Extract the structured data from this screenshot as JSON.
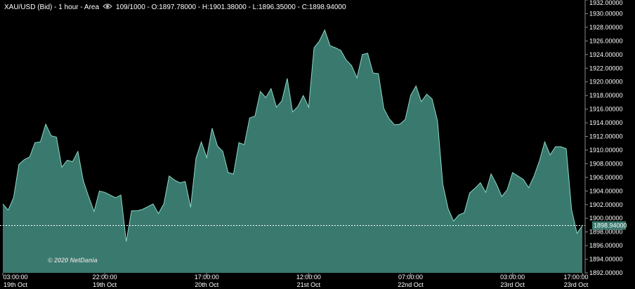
{
  "header": {
    "instrument": "XAU/USD (Bid) - 1 hour - Area",
    "stats": "109/1000 - O:1897.78000 - H:1901.38000 - L:1896.35000 - C:1898.94000",
    "eye_icon": "eye-icon"
  },
  "watermark": "© 2020 NetDania",
  "colors": {
    "area_fill": "#3a7a6e",
    "area_line": "#8ad8c6",
    "background": "#000000",
    "last_price_box": "#3a7a6e"
  },
  "chart_data": {
    "type": "area",
    "title": "XAU/USD (Bid) - 1 hour - Area",
    "ylim": [
      1892,
      1932
    ],
    "y_ticks": [
      "1932.00000",
      "1930.00000",
      "1928.00000",
      "1926.00000",
      "1924.00000",
      "1922.00000",
      "1920.00000",
      "1918.00000",
      "1916.00000",
      "1914.00000",
      "1912.00000",
      "1910.00000",
      "1908.00000",
      "1906.00000",
      "1904.00000",
      "1902.00000",
      "1900.00000",
      "1898.00000",
      "1896.00000",
      "1894.00000",
      "1892.00000"
    ],
    "x_ticks": [
      {
        "index": 0,
        "time": "03:00:00",
        "date": "19th Oct"
      },
      {
        "index": 19,
        "time": "22:00:00",
        "date": "19th Oct"
      },
      {
        "index": 38,
        "time": "17:00:00",
        "date": "20th Oct"
      },
      {
        "index": 57,
        "time": "12:00:00",
        "date": "21st Oct"
      },
      {
        "index": 76,
        "time": "07:00:00",
        "date": "22nd Oct"
      },
      {
        "index": 95,
        "time": "03:00:00",
        "date": "23rd Oct"
      },
      {
        "index": 108,
        "time": "17:00:00",
        "date": "23rd Oct"
      }
    ],
    "last_price": "1898.94000",
    "last_value": 1898.94,
    "values": [
      1902.1,
      1901.2,
      1903.0,
      1907.9,
      1908.6,
      1909.0,
      1911.1,
      1911.2,
      1913.8,
      1912.1,
      1911.9,
      1907.5,
      1908.5,
      1908.3,
      1909.8,
      1905.5,
      1903.2,
      1901.0,
      1904.0,
      1903.8,
      1903.4,
      1903.0,
      1903.4,
      1896.6,
      1901.1,
      1901.1,
      1901.3,
      1901.7,
      1902.1,
      1900.7,
      1902.1,
      1906.2,
      1905.6,
      1905.2,
      1905.4,
      1901.6,
      1908.8,
      1911.2,
      1908.9,
      1913.2,
      1910.6,
      1909.8,
      1906.7,
      1906.5,
      1911.1,
      1910.8,
      1914.7,
      1915.0,
      1918.6,
      1917.7,
      1919.0,
      1916.3,
      1917.2,
      1920.5,
      1915.6,
      1916.4,
      1918.0,
      1916.3,
      1925.0,
      1926.0,
      1927.6,
      1925.3,
      1925.0,
      1924.6,
      1923.2,
      1922.4,
      1920.6,
      1924.0,
      1924.2,
      1921.3,
      1921.2,
      1916.1,
      1914.6,
      1913.7,
      1913.8,
      1914.5,
      1918.0,
      1919.4,
      1917.1,
      1918.2,
      1917.5,
      1914.3,
      1905.0,
      1901.4,
      1899.6,
      1900.5,
      1900.8,
      1903.7,
      1904.4,
      1905.2,
      1903.8,
      1906.5,
      1905.0,
      1903.2,
      1904.2,
      1906.7,
      1906.2,
      1905.7,
      1904.5,
      1906.2,
      1908.4,
      1911.2,
      1909.3,
      1910.5,
      1910.5,
      1910.2,
      1901.3,
      1897.8,
      1898.9
    ]
  }
}
